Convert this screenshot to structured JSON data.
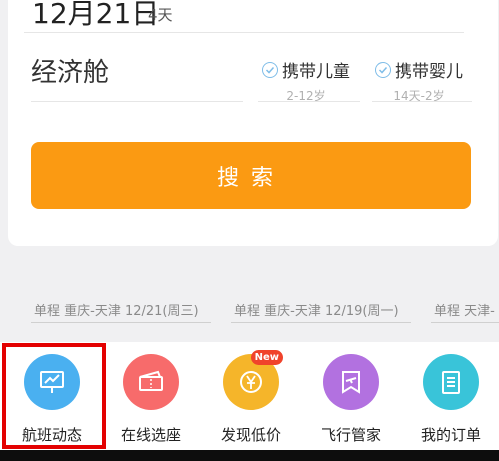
{
  "date": {
    "main": "12月21日",
    "sub": "4天"
  },
  "cabin": {
    "label": "经济舱"
  },
  "options": [
    {
      "label": "携带儿童",
      "sub": "2-12岁"
    },
    {
      "label": "携带婴儿",
      "sub": "14天-2岁"
    }
  ],
  "search": {
    "label": "搜索"
  },
  "history": [
    {
      "text": "单程 重庆-天津 12/21(周三)"
    },
    {
      "text": "单程 重庆-天津 12/19(周一)"
    },
    {
      "text": "单程 天津-"
    }
  ],
  "tabs": [
    {
      "label": "航班动态",
      "icon": "flight-status-icon",
      "color": "#4ab0f0"
    },
    {
      "label": "在线选座",
      "icon": "ticket-icon",
      "color": "#f76b6b"
    },
    {
      "label": "发现低价",
      "icon": "yen-coin-icon",
      "color": "#f5b52a",
      "badge": "New"
    },
    {
      "label": "飞行管家",
      "icon": "bookmark-plane-icon",
      "color": "#b271e0"
    },
    {
      "label": "我的订单",
      "icon": "clipboard-icon",
      "color": "#39c4d9"
    }
  ]
}
